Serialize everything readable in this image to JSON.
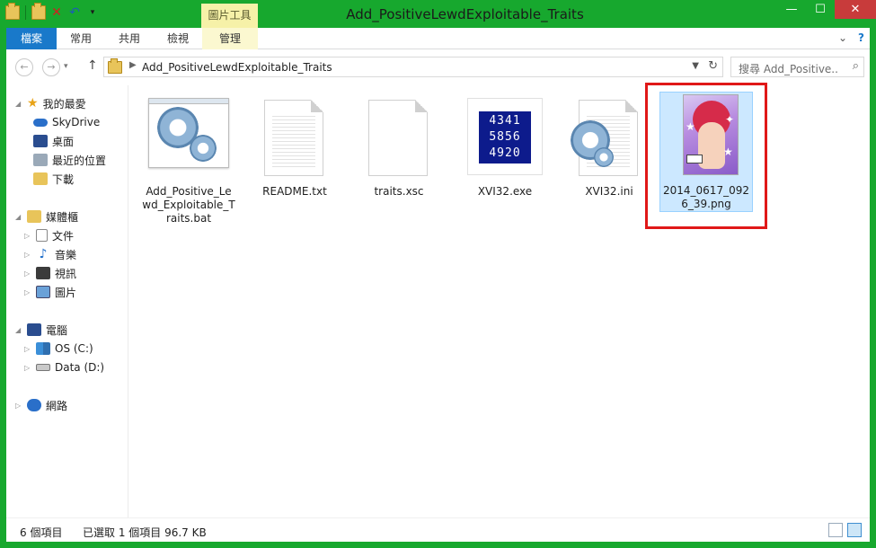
{
  "window": {
    "title": "Add_PositiveLewdExploitable_Traits",
    "context_tab_group": "圖片工具",
    "controls": {
      "minimize": "—",
      "maximize": "☐",
      "close": "✕"
    }
  },
  "ribbon": {
    "tabs": [
      {
        "label": "檔案"
      },
      {
        "label": "常用"
      },
      {
        "label": "共用"
      },
      {
        "label": "檢視"
      },
      {
        "label": "管理"
      }
    ]
  },
  "addressbar": {
    "path": "Add_PositiveLewdExploitable_Traits",
    "search_placeholder": "搜尋 Add_Positive..."
  },
  "navpane": {
    "favorites": {
      "label": "我的最愛",
      "items": [
        {
          "label": "SkyDrive"
        },
        {
          "label": "桌面"
        },
        {
          "label": "最近的位置"
        },
        {
          "label": "下載"
        }
      ]
    },
    "libraries": {
      "label": "媒體櫃",
      "items": [
        {
          "label": "文件"
        },
        {
          "label": "音樂"
        },
        {
          "label": "視訊"
        },
        {
          "label": "圖片"
        }
      ]
    },
    "computer": {
      "label": "電腦",
      "items": [
        {
          "label": "OS (C:)"
        },
        {
          "label": "Data (D:)"
        }
      ]
    },
    "network": {
      "label": "網路"
    }
  },
  "files": [
    {
      "name": "Add_Positive_Lewd_Exploitable_Traits.bat",
      "icon": "batch-gear-icon"
    },
    {
      "name": "README.txt",
      "icon": "text-document-icon"
    },
    {
      "name": "traits.xsc",
      "icon": "blank-document-icon"
    },
    {
      "name": "XVI32.exe",
      "icon": "hex-editor-icon",
      "icon_text": [
        "4341",
        "5856",
        "4920"
      ]
    },
    {
      "name": "XVI32.ini",
      "icon": "settings-document-icon"
    },
    {
      "name": "2014_0617_0926_39.png",
      "icon": "image-thumbnail",
      "selected": true
    }
  ],
  "statusbar": {
    "item_count": "6 個項目",
    "selection": "已選取 1 個項目 96.7 KB"
  },
  "colors": {
    "window_frame": "#17a82e",
    "file_tab": "#1979ca",
    "context_tab": "#f6f1a8",
    "selection_bg": "#cce8ff",
    "highlight_box": "#e01818"
  }
}
